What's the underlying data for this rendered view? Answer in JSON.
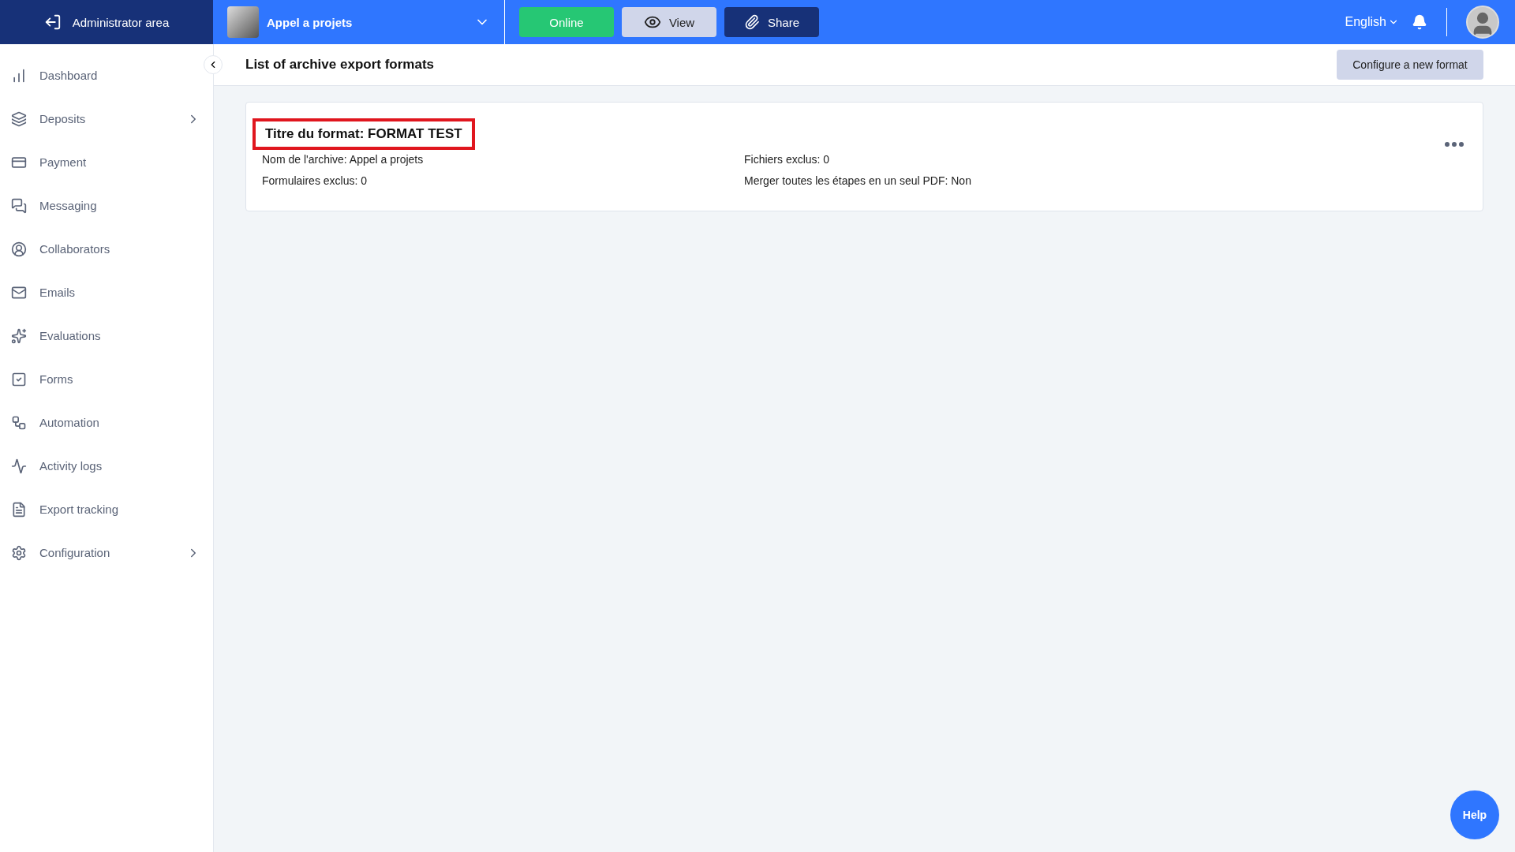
{
  "topbar": {
    "admin_label": "Administrator area",
    "project": "Appel a projets",
    "status_button": "Online",
    "view_button": "View",
    "share_button": "Share",
    "language": "English"
  },
  "sidebar": {
    "items": [
      {
        "label": "Dashboard",
        "expandable": false
      },
      {
        "label": "Deposits",
        "expandable": true
      },
      {
        "label": "Payment",
        "expandable": false
      },
      {
        "label": "Messaging",
        "expandable": false
      },
      {
        "label": "Collaborators",
        "expandable": false
      },
      {
        "label": "Emails",
        "expandable": false
      },
      {
        "label": "Evaluations",
        "expandable": false
      },
      {
        "label": "Forms",
        "expandable": false
      },
      {
        "label": "Automation",
        "expandable": false
      },
      {
        "label": "Activity logs",
        "expandable": false
      },
      {
        "label": "Export tracking",
        "expandable": false
      },
      {
        "label": "Configuration",
        "expandable": true
      }
    ]
  },
  "page": {
    "title": "List of archive export formats",
    "action_button": "Configure a new format"
  },
  "formats": [
    {
      "title": "Titre du format: FORMAT TEST",
      "highlighted": true,
      "details": [
        "Nom de l'archive: Appel a projets",
        "Fichiers exclus: 0",
        "Formulaires exclus: 0",
        "Merger toutes les étapes en un seul PDF: Non"
      ]
    }
  ],
  "help_button": "Help"
}
